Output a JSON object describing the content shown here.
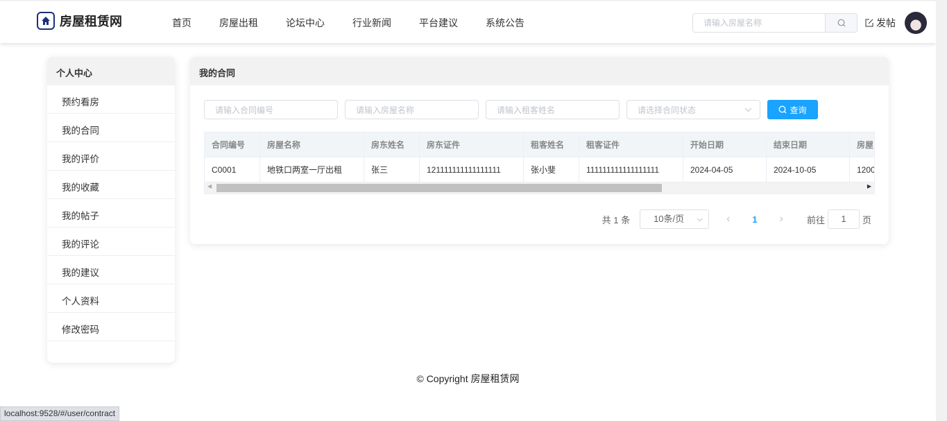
{
  "header": {
    "brand": "房屋租赁网",
    "nav": [
      "首页",
      "房屋出租",
      "论坛中心",
      "行业新闻",
      "平台建议",
      "系统公告"
    ],
    "search_placeholder": "请输入房屋名称",
    "post_label": "发帖"
  },
  "sidebar": {
    "title": "个人中心",
    "items": [
      "预约看房",
      "我的合同",
      "我的评价",
      "我的收藏",
      "我的帖子",
      "我的评论",
      "我的建议",
      "个人资料",
      "修改密码"
    ]
  },
  "main": {
    "title": "我的合同",
    "filters": {
      "contract_no": "请输入合同编号",
      "house_name": "请输入房屋名称",
      "tenant_name": "请输入租客姓名",
      "status": "请选择合同状态",
      "query_label": "查询"
    },
    "table": {
      "headers": [
        "合同编号",
        "房屋名称",
        "房东姓名",
        "房东证件",
        "租客姓名",
        "租客证件",
        "开始日期",
        "结束日期",
        "房屋"
      ],
      "rows": [
        [
          "C0001",
          "地铁口两室一厅出租",
          "张三",
          "121111111111111111",
          "张小斐",
          "111111111111111111",
          "2024-04-05",
          "2024-10-05",
          "1200"
        ]
      ]
    },
    "pagination": {
      "total": "共 1 条",
      "page_size": "10条/页",
      "current": "1",
      "goto_label": "前往",
      "goto_value": "1",
      "page_suffix": "页"
    }
  },
  "footer": "© Copyright 房屋租赁网",
  "status_url": "localhost:9528/#/user/contract"
}
